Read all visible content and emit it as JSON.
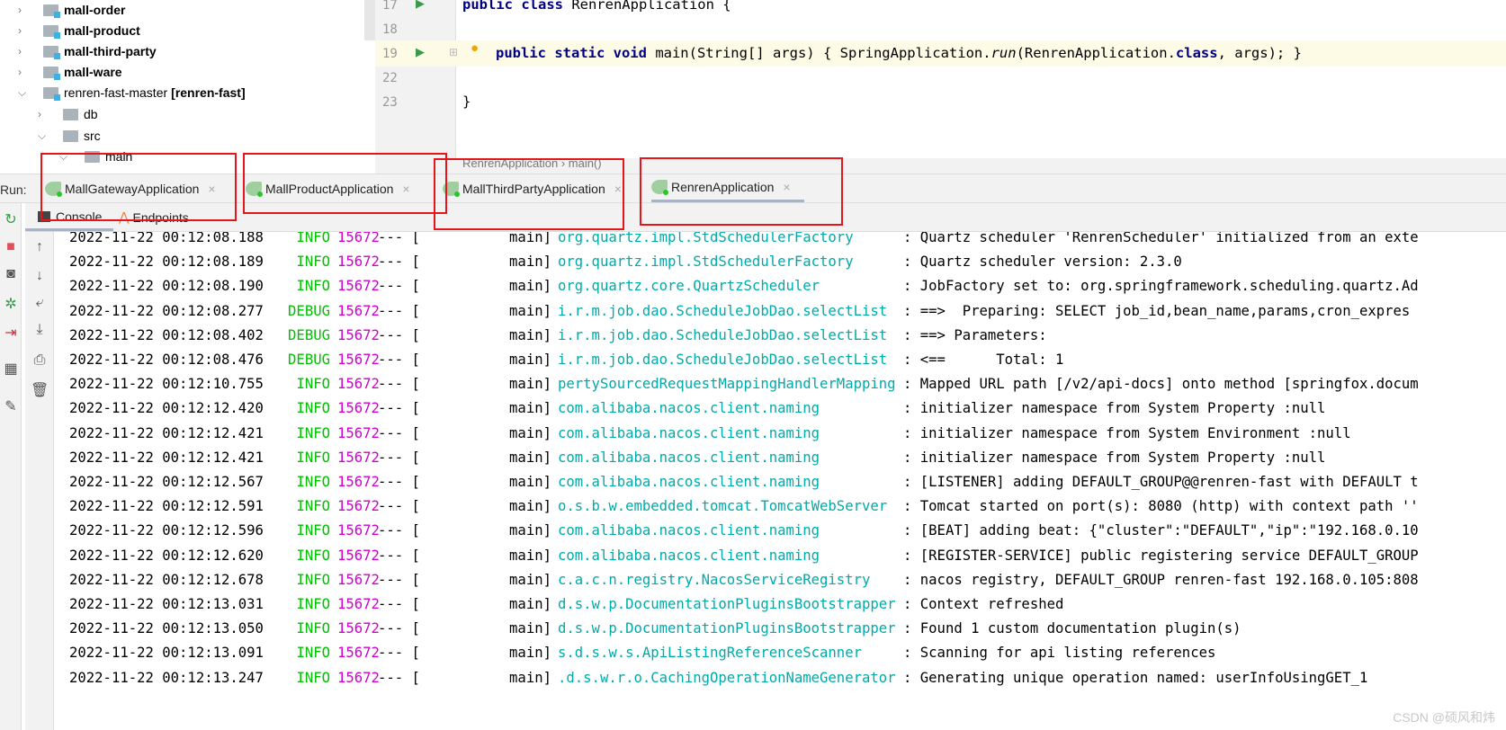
{
  "project_tree": {
    "items": [
      {
        "label": "mall-order",
        "bold": true,
        "expanded": false
      },
      {
        "label": "mall-product",
        "bold": true,
        "expanded": false
      },
      {
        "label": "mall-third-party",
        "bold": true,
        "expanded": false
      },
      {
        "label": "mall-ware",
        "bold": true,
        "expanded": false
      },
      {
        "label": "renren-fast-master",
        "suffix": "[renren-fast]",
        "expanded": true
      },
      {
        "label": "db",
        "expanded": false
      },
      {
        "label": "src",
        "expanded": true
      },
      {
        "label": "main",
        "expanded": true
      }
    ]
  },
  "editor": {
    "lines": [
      {
        "num": "17",
        "tokens": [
          {
            "t": "public class",
            "kw": true
          },
          {
            "t": " RenrenApplication {"
          }
        ]
      },
      {
        "num": "18",
        "tokens": []
      },
      {
        "num": "19",
        "tokens": [
          {
            "t": "public ",
            "kw": true
          },
          {
            "t": "static void",
            "kw": true
          },
          {
            "t": " main(String[] args) { SpringApplication."
          },
          {
            "t": "run",
            "it": true
          },
          {
            "t": "(RenrenApplication."
          },
          {
            "t": "class",
            "kw": true
          },
          {
            "t": ", args); }"
          }
        ]
      },
      {
        "num": "22",
        "tokens": []
      },
      {
        "num": "23",
        "tokens": [
          {
            "t": "}"
          }
        ]
      }
    ],
    "breadcrumb": [
      "RenrenApplication",
      "main()"
    ]
  },
  "run": {
    "label": "Run:",
    "tabs": [
      {
        "label": "MallGatewayApplication",
        "active": false
      },
      {
        "label": "MallProductApplication",
        "active": false
      },
      {
        "label": "MallThirdPartyApplication",
        "active": false
      },
      {
        "label": "RenrenApplication",
        "active": true
      }
    ],
    "subtabs": [
      "Console",
      "Endpoints"
    ]
  },
  "log": [
    {
      "ts": "2022-11-22 00:12:08.188",
      "level": "INFO",
      "pid": "15672",
      "thread": "main]",
      "logger": "org.quartz.impl.StdSchedulerFactory",
      "msg": ": Quartz scheduler 'RenrenScheduler' initialized from an exte"
    },
    {
      "ts": "2022-11-22 00:12:08.189",
      "level": "INFO",
      "pid": "15672",
      "thread": "main]",
      "logger": "org.quartz.impl.StdSchedulerFactory",
      "msg": ": Quartz scheduler version: 2.3.0"
    },
    {
      "ts": "2022-11-22 00:12:08.190",
      "level": "INFO",
      "pid": "15672",
      "thread": "main]",
      "logger": "org.quartz.core.QuartzScheduler",
      "msg": ": JobFactory set to: org.springframework.scheduling.quartz.Ad"
    },
    {
      "ts": "2022-11-22 00:12:08.277",
      "level": "DEBUG",
      "pid": "15672",
      "thread": "main]",
      "logger": "i.r.m.job.dao.ScheduleJobDao.selectList",
      "msg": ": ==>  Preparing: SELECT job_id,bean_name,params,cron_expres"
    },
    {
      "ts": "2022-11-22 00:12:08.402",
      "level": "DEBUG",
      "pid": "15672",
      "thread": "main]",
      "logger": "i.r.m.job.dao.ScheduleJobDao.selectList",
      "msg": ": ==> Parameters: "
    },
    {
      "ts": "2022-11-22 00:12:08.476",
      "level": "DEBUG",
      "pid": "15672",
      "thread": "main]",
      "logger": "i.r.m.job.dao.ScheduleJobDao.selectList",
      "msg": ": <==      Total: 1"
    },
    {
      "ts": "2022-11-22 00:12:10.755",
      "level": "INFO",
      "pid": "15672",
      "thread": "main]",
      "logger": "pertySourcedRequestMappingHandlerMapping",
      "msg": ": Mapped URL path [/v2/api-docs] onto method [springfox.docum"
    },
    {
      "ts": "2022-11-22 00:12:12.420",
      "level": "INFO",
      "pid": "15672",
      "thread": "main]",
      "logger": "com.alibaba.nacos.client.naming",
      "msg": ": initializer namespace from System Property :null"
    },
    {
      "ts": "2022-11-22 00:12:12.421",
      "level": "INFO",
      "pid": "15672",
      "thread": "main]",
      "logger": "com.alibaba.nacos.client.naming",
      "msg": ": initializer namespace from System Environment :null"
    },
    {
      "ts": "2022-11-22 00:12:12.421",
      "level": "INFO",
      "pid": "15672",
      "thread": "main]",
      "logger": "com.alibaba.nacos.client.naming",
      "msg": ": initializer namespace from System Property :null"
    },
    {
      "ts": "2022-11-22 00:12:12.567",
      "level": "INFO",
      "pid": "15672",
      "thread": "main]",
      "logger": "com.alibaba.nacos.client.naming",
      "msg": ": [LISTENER] adding DEFAULT_GROUP@@renren-fast with DEFAULT t"
    },
    {
      "ts": "2022-11-22 00:12:12.591",
      "level": "INFO",
      "pid": "15672",
      "thread": "main]",
      "logger": "o.s.b.w.embedded.tomcat.TomcatWebServer",
      "msg": ": Tomcat started on port(s): 8080 (http) with context path ''"
    },
    {
      "ts": "2022-11-22 00:12:12.596",
      "level": "INFO",
      "pid": "15672",
      "thread": "main]",
      "logger": "com.alibaba.nacos.client.naming",
      "msg": ": [BEAT] adding beat: {\"cluster\":\"DEFAULT\",\"ip\":\"192.168.0.10"
    },
    {
      "ts": "2022-11-22 00:12:12.620",
      "level": "INFO",
      "pid": "15672",
      "thread": "main]",
      "logger": "com.alibaba.nacos.client.naming",
      "msg": ": [REGISTER-SERVICE] public registering service DEFAULT_GROUP"
    },
    {
      "ts": "2022-11-22 00:12:12.678",
      "level": "INFO",
      "pid": "15672",
      "thread": "main]",
      "logger": "c.a.c.n.registry.NacosServiceRegistry",
      "msg": ": nacos registry, DEFAULT_GROUP renren-fast 192.168.0.105:808"
    },
    {
      "ts": "2022-11-22 00:12:13.031",
      "level": "INFO",
      "pid": "15672",
      "thread": "main]",
      "logger": "d.s.w.p.DocumentationPluginsBootstrapper",
      "msg": ": Context refreshed"
    },
    {
      "ts": "2022-11-22 00:12:13.050",
      "level": "INFO",
      "pid": "15672",
      "thread": "main]",
      "logger": "d.s.w.p.DocumentationPluginsBootstrapper",
      "msg": ": Found 1 custom documentation plugin(s)"
    },
    {
      "ts": "2022-11-22 00:12:13.091",
      "level": "INFO",
      "pid": "15672",
      "thread": "main]",
      "logger": "s.d.s.w.s.ApiListingReferenceScanner",
      "msg": ": Scanning for api listing references"
    },
    {
      "ts": "2022-11-22 00:12:13.247",
      "level": "INFO",
      "pid": "15672",
      "thread": "main]",
      "logger": ".d.s.w.r.o.CachingOperationNameGenerator",
      "msg": ": Generating unique operation named: userInfoUsingGET_1"
    }
  ],
  "colors": {
    "info": "#00c000",
    "debug": "#00c000",
    "pid": "#d000d0",
    "logger": "#00aaaa",
    "highlight_box": "#e8141c"
  },
  "watermark": "CSDN @硕风和炜"
}
